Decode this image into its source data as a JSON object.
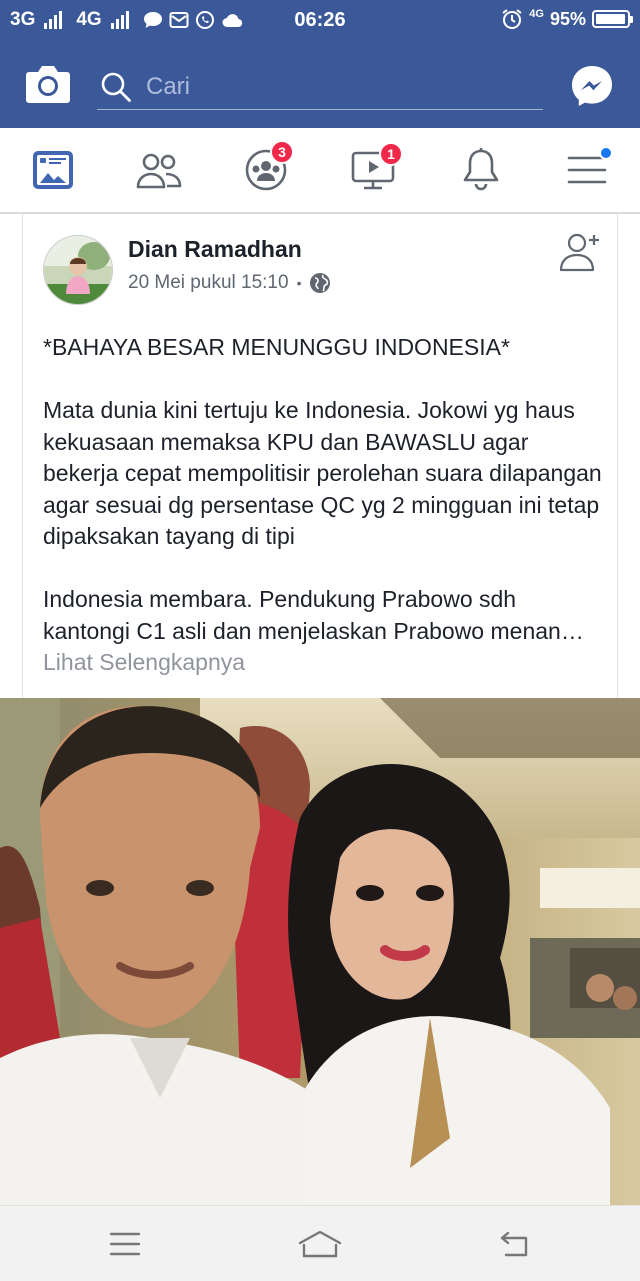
{
  "status_bar": {
    "network_1": "3G",
    "network_2": "4G",
    "time": "06:26",
    "network_3": "4G",
    "battery_text": "95%",
    "battery_level": 0.95
  },
  "header": {
    "search_placeholder": "Cari",
    "brand_color": "#3b5998"
  },
  "nav": {
    "tabs": [
      {
        "name": "news-feed",
        "badge": ""
      },
      {
        "name": "friends",
        "badge": ""
      },
      {
        "name": "groups",
        "badge": "3"
      },
      {
        "name": "watch",
        "badge": "1"
      },
      {
        "name": "notifications",
        "badge": ""
      },
      {
        "name": "menu",
        "badge": ""
      }
    ],
    "active_color": "#4267b2",
    "badge_color": "#f02849"
  },
  "post": {
    "author": "Dian Ramadhan",
    "timestamp": "20 Mei pukul 15:10",
    "separator": "•",
    "title": "*BAHAYA BESAR MENUNGGU INDONESIA*",
    "paragraph_1": "Mata dunia kini tertuju ke Indonesia.  Jokowi yg haus kekuasaan memaksa KPU dan BAWASLU agar bekerja cepat mempolitisir perolehan suara dilapangan agar sesuai dg persentase QC yg 2 mingguan ini tetap dipaksakan tayang di tipi",
    "paragraph_2": "Indonesia membara.  Pendukung Prabowo sdh kantongi C1 asli dan menjelaskan Prabowo menan…",
    "see_more": "Lihat Selengkapnya"
  }
}
